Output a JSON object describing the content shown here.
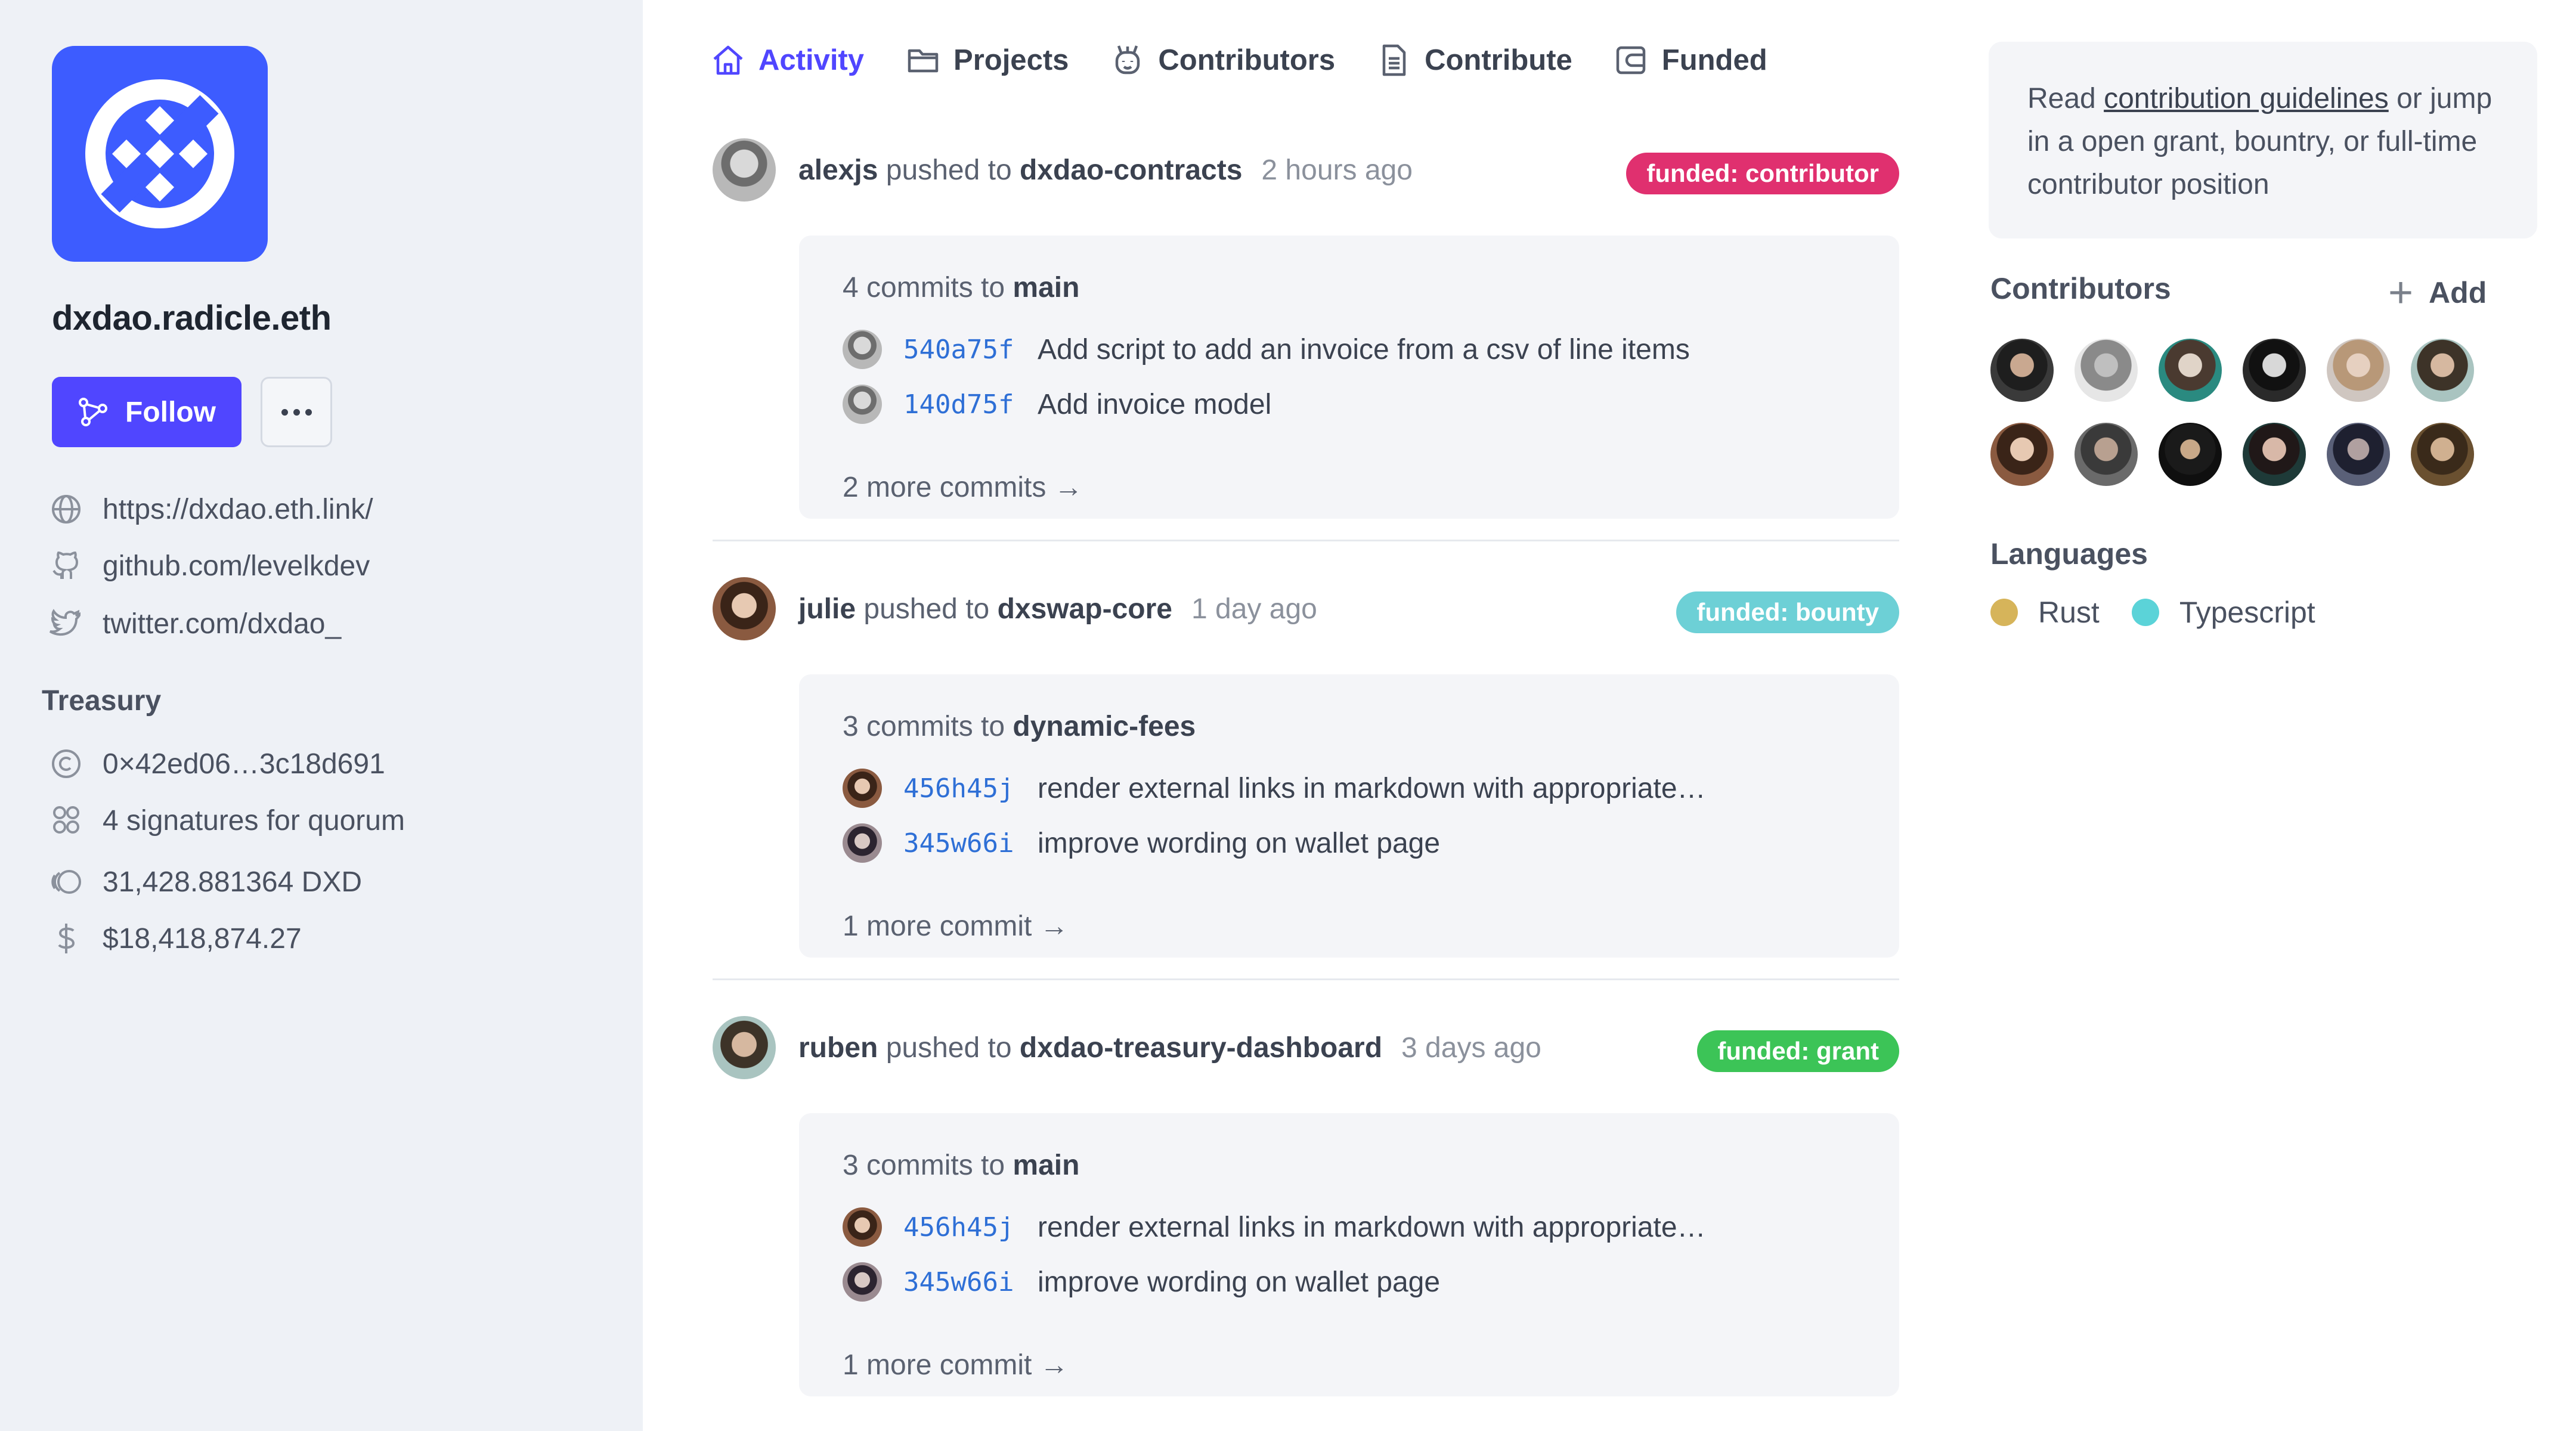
{
  "org": {
    "name": "dxdao.radicle.eth",
    "follow_label": "Follow",
    "website": "https://dxdao.eth.link/",
    "github": "github.com/levelkdev",
    "twitter": "twitter.com/dxdao_"
  },
  "treasury": {
    "title": "Treasury",
    "address": "0×42ed06…3c18d691",
    "quorum": "4 signatures for quorum",
    "balance_token": "31,428.881364 DXD",
    "balance_usd": "$18,418,874.27"
  },
  "tabs": [
    {
      "label": "Activity",
      "icon": "home-icon",
      "active": true
    },
    {
      "label": "Projects",
      "icon": "folder-icon"
    },
    {
      "label": "Contributors",
      "icon": "contributors-icon"
    },
    {
      "label": "Contribute",
      "icon": "document-icon"
    },
    {
      "label": "Funded",
      "icon": "wallet-icon"
    }
  ],
  "events": [
    {
      "user": "alexjs",
      "action": "pushed to",
      "repo": "dxdao-contracts",
      "time": "2 hours ago",
      "badge": "funded: contributor",
      "badge_color": "#e0306f",
      "commits_prefix": "4 commits to",
      "branch": "main",
      "commits": [
        {
          "sha": "540a75f",
          "message": "Add script to add an invoice from a csv of line items"
        },
        {
          "sha": "140d75f",
          "message": "Add invoice model"
        }
      ],
      "more": "2 more commits →"
    },
    {
      "user": "julie",
      "action": "pushed to",
      "repo": "dxswap-core",
      "time": "1 day ago",
      "badge": "funded: bounty",
      "badge_color": "#6dd0d6",
      "commits_prefix": "3 commits to",
      "branch": "dynamic-fees",
      "commits": [
        {
          "sha": "456h45j",
          "message": "render external links in markdown with appropriate…"
        },
        {
          "sha": "345w66i",
          "message": "improve wording on wallet page"
        }
      ],
      "more": "1 more commit →"
    },
    {
      "user": "ruben",
      "action": "pushed to",
      "repo": "dxdao-treasury-dashboard",
      "time": "3 days ago",
      "badge": "funded: grant",
      "badge_color": "#3cc457",
      "commits_prefix": "3 commits to",
      "branch": "main",
      "commits": [
        {
          "sha": "456h45j",
          "message": "render external links in markdown with appropriate…"
        },
        {
          "sha": "345w66i",
          "message": "improve wording on wallet page"
        }
      ],
      "more": "1 more commit →"
    }
  ],
  "guide": {
    "prefix": "Read",
    "link": "contribution guidelines",
    "suffix": "or jump in a open grant, bountry, or full-time contributor position"
  },
  "contributors": {
    "title": "Contributors",
    "add_label": "Add",
    "count": 12
  },
  "languages": {
    "title": "Languages",
    "items": [
      {
        "name": "Rust",
        "color": "#d6b45a"
      },
      {
        "name": "Typescript",
        "color": "#5bd3d8"
      }
    ]
  },
  "colors": {
    "accent": "#5046ff",
    "logo": "#3d5cff",
    "sha": "#2e6fd6"
  }
}
